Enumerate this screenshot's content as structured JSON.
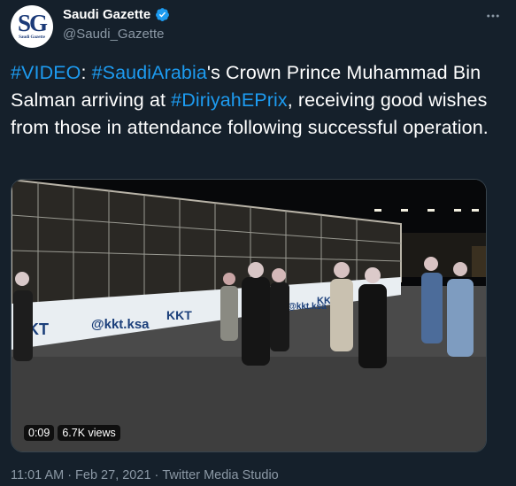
{
  "author": {
    "display_name": "Saudi Gazette",
    "handle": "@Saudi_Gazette",
    "avatar_text": "SG",
    "avatar_subtext": "Saudi Gazette",
    "verified": true
  },
  "tweet": {
    "segments": [
      {
        "text": "#VIDEO",
        "type": "hashtag"
      },
      {
        "text": ": ",
        "type": "text"
      },
      {
        "text": "#SaudiArabia",
        "type": "hashtag"
      },
      {
        "text": "'s Crown Prince Muhammad Bin Salman arriving at ",
        "type": "text"
      },
      {
        "text": "#DiriyahEPrix",
        "type": "hashtag"
      },
      {
        "text": ", receiving good wishes from those in attendance following successful operation.",
        "type": "text"
      }
    ]
  },
  "media": {
    "duration": "0:09",
    "views": "6.7K views",
    "banner_texts": [
      "KT",
      "@kkt.ksa",
      "KKT",
      "@kkt.ksa",
      "KKT"
    ]
  },
  "meta": {
    "time": "11:01 AM",
    "separator": "·",
    "date": "Feb 27, 2021",
    "source": "Twitter Media Studio"
  },
  "colors": {
    "background": "#15202b",
    "text": "#ffffff",
    "secondary": "#8b98a5",
    "link": "#1d9bf0",
    "verified": "#1d9bf0"
  },
  "icons": [
    "verified-badge-icon",
    "more-options-icon"
  ]
}
